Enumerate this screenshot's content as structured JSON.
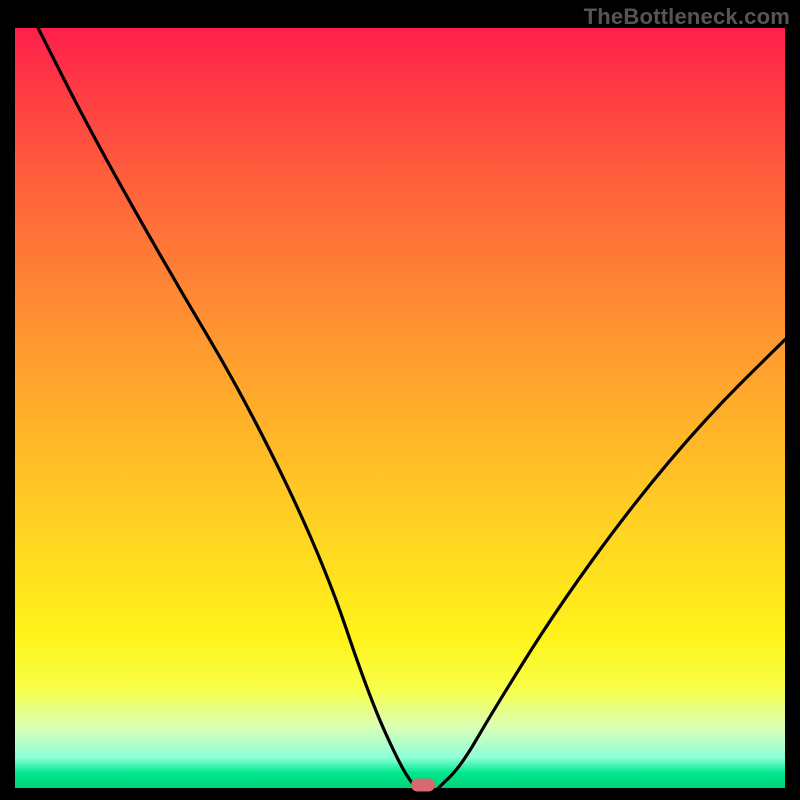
{
  "watermark": "TheBottleneck.com",
  "chart_data": {
    "type": "line",
    "title": "",
    "xlabel": "",
    "ylabel": "",
    "xlim": [
      0,
      100
    ],
    "ylim": [
      0,
      100
    ],
    "grid": false,
    "legend": false,
    "series": [
      {
        "name": "left-arm",
        "x": [
          3,
          10,
          20,
          30,
          40,
          46,
          50,
          52
        ],
        "values": [
          100,
          86,
          68,
          51,
          30,
          12,
          3,
          0
        ]
      },
      {
        "name": "right-arm",
        "x": [
          55,
          58,
          62,
          70,
          80,
          90,
          100
        ],
        "values": [
          0,
          3,
          10,
          23,
          37,
          49,
          59
        ]
      }
    ],
    "minimum_marker": {
      "x": 53,
      "y": 0
    },
    "line_color": "#000000",
    "marker_color": "#d66a6f",
    "gradient_stops": [
      {
        "pos": 0,
        "color": "#ff1f4b"
      },
      {
        "pos": 50,
        "color": "#ff9a2f"
      },
      {
        "pos": 80,
        "color": "#fff31a"
      },
      {
        "pos": 100,
        "color": "#00d27b"
      }
    ]
  }
}
